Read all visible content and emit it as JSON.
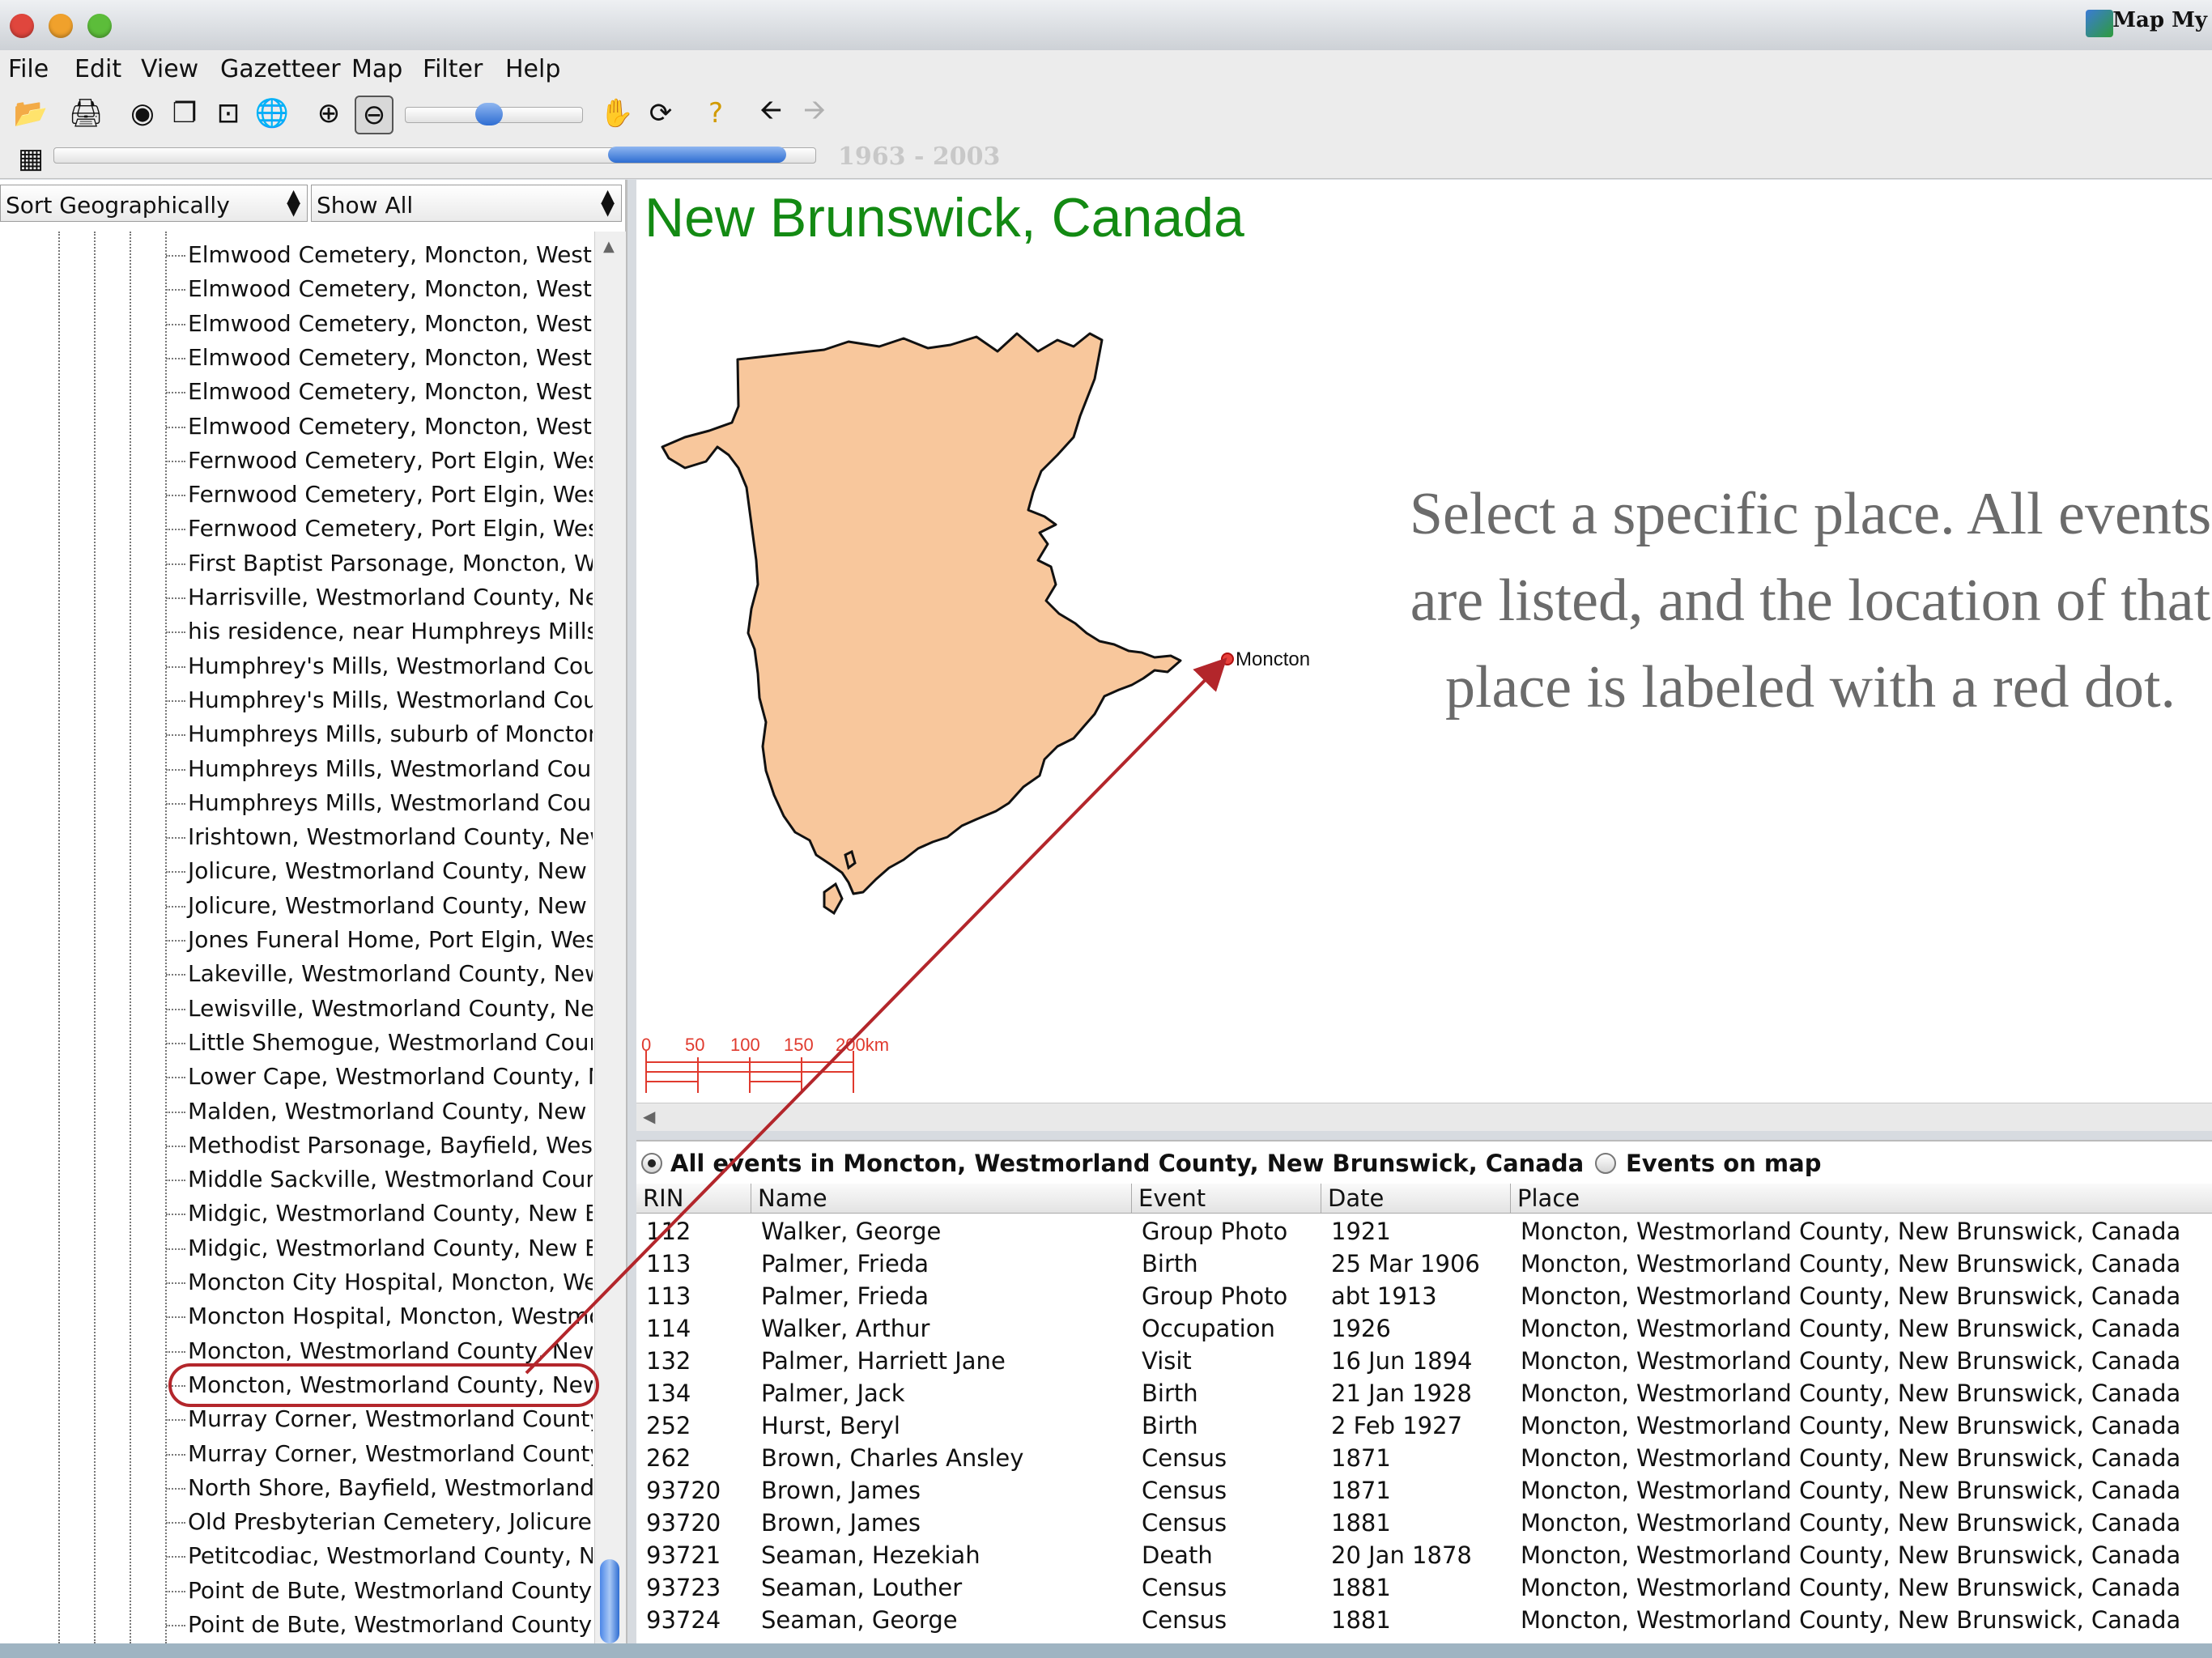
{
  "window": {
    "title": "Map My"
  },
  "menu": [
    "File",
    "Edit",
    "View",
    "Gazetteer",
    "Map",
    "Filter",
    "Help"
  ],
  "toolbar_icons": [
    "open-folder-icon",
    "print-icon",
    "binoculars-icon",
    "copy-icon",
    "zoom-extent-icon",
    "globe-icon",
    "zoom-in-icon",
    "zoom-out-icon",
    "pan-hand-icon",
    "refresh-icon",
    "help-icon",
    "back-arrow-icon",
    "forward-arrow-icon"
  ],
  "timeline": {
    "years": "1963 - 2003"
  },
  "left": {
    "sort_select": "Sort Geographically",
    "filter_select": "Show All",
    "places": [
      "Elmwood Cemetery, Moncton, Westm",
      "Elmwood Cemetery, Moncton, Westm",
      "Elmwood Cemetery, Moncton, Westm",
      "Elmwood Cemetery, Moncton, Westm",
      "Elmwood Cemetery, Moncton, Westm",
      "Elmwood Cemetery, Moncton, Westm",
      "Fernwood Cemetery, Port Elgin, West",
      "Fernwood Cemetery, Port Elgin, West",
      "Fernwood Cemetery, Port Elgin, West",
      "First Baptist Parsonage, Moncton, We",
      "Harrisville, Westmorland County, New",
      "his residence, near Humphreys Mills,",
      "Humphrey's Mills, Westmorland Coun",
      "Humphrey's Mills, Westmorland Coun",
      "Humphreys Mills, suburb of Moncton,",
      "Humphreys Mills, Westmorland Count",
      "Humphreys Mills, Westmorland Count",
      "Irishtown, Westmorland County, New",
      "Jolicure, Westmorland County, New B",
      "Jolicure, Westmorland County, New B",
      "Jones Funeral Home, Port Elgin, West",
      "Lakeville, Westmorland County, New I",
      "Lewisville, Westmorland County, New",
      "Little Shemogue, Westmorland Count",
      "Lower Cape, Westmorland County, Ne",
      "Malden, Westmorland County, New Br",
      "Methodist Parsonage, Bayfield, Westm",
      "Middle Sackville, Westmorland County",
      "Midgic, Westmorland County, New Bru",
      "Midgic, Westmorland County, New Bru",
      "Moncton City Hospital, Moncton, West",
      "Moncton Hospital, Moncton, Westmor",
      "Moncton, Westmorland County, New I",
      "Moncton, Westmorland County, New I",
      "Murray Corner, Westmorland County,",
      "Murray Corner, Westmorland County,",
      "North Shore, Bayfield, Westmorland C",
      "Old Presbyterian Cemetery, Jolicure, '",
      "Petitcodiac, Westmorland County, Nev",
      "Point de Bute, Westmorland County, N",
      "Point de Bute, Westmorland County, N"
    ],
    "selected_index": 33
  },
  "map": {
    "title": "New Brunswick, Canada",
    "marker_label": "Moncton",
    "scale_labels": [
      "0",
      "50",
      "100",
      "150",
      "200km"
    ],
    "caption": "Select a specific place.  All events are listed, and the location of that place is labeled with a red dot."
  },
  "events": {
    "all_events_label": "All events in Moncton, Westmorland County, New Brunswick, Canada",
    "on_map_label": "Events on map",
    "columns": [
      "RIN",
      "Name",
      "Event",
      "Date",
      "Place"
    ],
    "rows": [
      [
        "112",
        "Walker, George",
        "Group Photo",
        "1921",
        "Moncton, Westmorland County, New Brunswick, Canada"
      ],
      [
        "113",
        "Palmer, Frieda",
        "Birth",
        "25 Mar 1906",
        "Moncton, Westmorland County, New Brunswick, Canada"
      ],
      [
        "113",
        "Palmer, Frieda",
        "Group Photo",
        "abt 1913",
        "Moncton, Westmorland County, New Brunswick, Canada"
      ],
      [
        "114",
        "Walker, Arthur",
        "Occupation",
        "1926",
        "Moncton, Westmorland County, New Brunswick, Canada"
      ],
      [
        "132",
        "Palmer, Harriett Jane",
        "Visit",
        "16 Jun 1894",
        "Moncton, Westmorland County, New Brunswick, Canada"
      ],
      [
        "134",
        "Palmer, Jack",
        "Birth",
        "21 Jan 1928",
        "Moncton, Westmorland County, New Brunswick, Canada"
      ],
      [
        "252",
        "Hurst, Beryl",
        "Birth",
        "2 Feb 1927",
        "Moncton, Westmorland County, New Brunswick, Canada"
      ],
      [
        "262",
        "Brown, Charles Ansley",
        "Census",
        "1871",
        "Moncton, Westmorland County, New Brunswick, Canada"
      ],
      [
        "93720",
        "Brown, James",
        "Census",
        "1871",
        "Moncton, Westmorland County, New Brunswick, Canada"
      ],
      [
        "93720",
        "Brown, James",
        "Census",
        "1881",
        "Moncton, Westmorland County, New Brunswick, Canada"
      ],
      [
        "93721",
        "Seaman, Hezekiah",
        "Death",
        "20 Jan 1878",
        "Moncton, Westmorland County, New Brunswick, Canada"
      ],
      [
        "93723",
        "Seaman, Louther",
        "Census",
        "1881",
        "Moncton, Westmorland County, New Brunswick, Canada"
      ],
      [
        "93724",
        "Seaman, George",
        "Census",
        "1881",
        "Moncton, Westmorland County, New Brunswick, Canada"
      ]
    ]
  },
  "colors": {
    "map_fill": "#f8c79c",
    "title_green": "#138a13",
    "annotation_red": "#b3262b",
    "marker_red": "#e8403b"
  }
}
